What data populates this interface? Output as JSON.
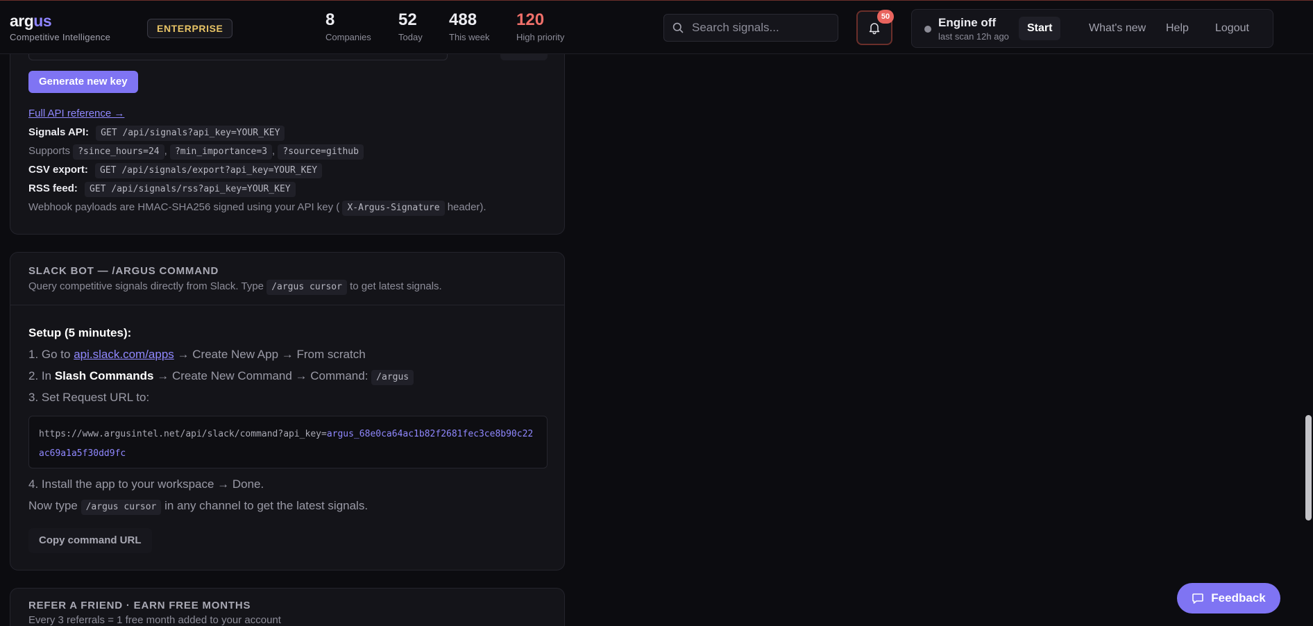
{
  "header": {
    "brand_prefix": "arg",
    "brand_suffix": "us",
    "brand_subtitle": "Competitive Intelligence",
    "plan_badge": "ENTERPRISE",
    "stats": [
      {
        "value": "8",
        "label": "Companies"
      },
      {
        "value": "52",
        "label": "Today"
      },
      {
        "value": "488",
        "label": "This week"
      },
      {
        "value": "120",
        "label": "High priority"
      }
    ],
    "search_placeholder": "Search signals...",
    "notification_count": "50",
    "engine": {
      "title": "Engine off",
      "subtitle": "last scan 12h ago",
      "start": "Start",
      "whats_new": "What's new",
      "help": "Help",
      "logout": "Logout"
    }
  },
  "api_card": {
    "generate_key": "Generate new key",
    "full_reference": "Full API reference →",
    "signals_label": "Signals API:",
    "signals_code": "GET /api/signals?api_key=YOUR_KEY",
    "supports_text": "Supports",
    "supports_param_1": "?since_hours=24",
    "supports_param_2": "?min_importance=3",
    "supports_param_3": "?source=github",
    "csv_label": "CSV export:",
    "csv_code": "GET /api/signals/export?api_key=YOUR_KEY",
    "rss_label": "RSS feed:",
    "rss_code": "GET /api/signals/rss?api_key=YOUR_KEY",
    "webhook_text_before": "Webhook payloads are HMAC-SHA256 signed using your API key (",
    "webhook_code": "X-Argus-Signature",
    "webhook_text_after": "header)."
  },
  "slack_card": {
    "title": "SLACK BOT — /ARGUS COMMAND",
    "subtitle_before": "Query competitive signals directly from Slack. Type",
    "subtitle_code": "/argus cursor",
    "subtitle_after": "to get latest signals.",
    "setup_heading": "Setup (5 minutes):",
    "step1_before": "1. Go to",
    "step1_link": "api.slack.com/apps",
    "step1_after": "→ Create New App → From scratch",
    "step2_before": "2. In",
    "step2_bold": "Slash Commands",
    "step2_after": "→ Create New Command → Command:",
    "step2_code": "/argus",
    "step3": "3. Set Request URL to:",
    "url_base": "https://www.argusintel.net/api/slack/command?api_key=",
    "url_key": "argus_68e0ca64ac1b82f2681fec3ce8b90c22ac69a1a5f30dd9fc",
    "step4": "4. Install the app to your workspace → Done.",
    "now_before": "Now type",
    "now_code": "/argus cursor",
    "now_after": "in any channel to get the latest signals.",
    "copy_button": "Copy command URL"
  },
  "refer_card": {
    "title": "REFER A FRIEND · EARN FREE MONTHS",
    "subtitle": "Every 3 referrals = 1 free month added to your account"
  },
  "feedback_button": "Feedback"
}
